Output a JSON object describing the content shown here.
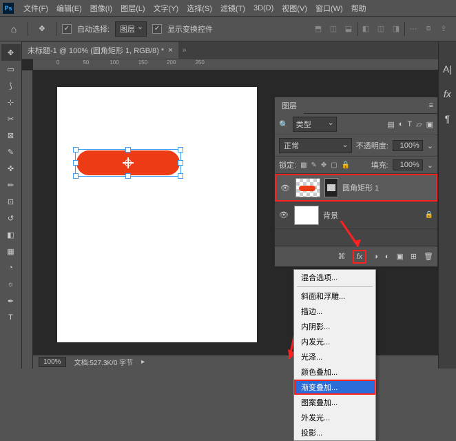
{
  "menubar": {
    "items": [
      "文件(F)",
      "编辑(E)",
      "图像(I)",
      "图层(L)",
      "文字(Y)",
      "选择(S)",
      "滤镜(T)",
      "3D(D)",
      "视图(V)",
      "窗口(W)",
      "帮助"
    ]
  },
  "optionsbar": {
    "auto_select_label": "自动选择:",
    "auto_select_target": "图层",
    "show_transform_label": "显示变换控件"
  },
  "document": {
    "tab_title": "未标题-1 @ 100% (圆角矩形 1, RGB/8) *",
    "zoom": "100%",
    "status": "文档:527.3K/0 字节",
    "ruler_marks": [
      "0",
      "50",
      "100",
      "150",
      "200",
      "250"
    ]
  },
  "layers_panel": {
    "tab_label": "图层",
    "type_filter": "类型",
    "blend_mode": "正常",
    "opacity_label": "不透明度:",
    "opacity_value": "100%",
    "lock_label": "锁定:",
    "fill_label": "填充:",
    "fill_value": "100%",
    "layers": [
      {
        "name": "圆角矩形 1",
        "selected": true
      },
      {
        "name": "背景",
        "locked": true
      }
    ],
    "fx_button": "fx"
  },
  "fx_menu": {
    "items": [
      "混合选项...",
      "斜面和浮雕...",
      "描边...",
      "内阴影...",
      "内发光...",
      "光泽...",
      "颜色叠加...",
      "渐变叠加...",
      "图案叠加...",
      "外发光...",
      "投影..."
    ],
    "highlighted_index": 7
  }
}
